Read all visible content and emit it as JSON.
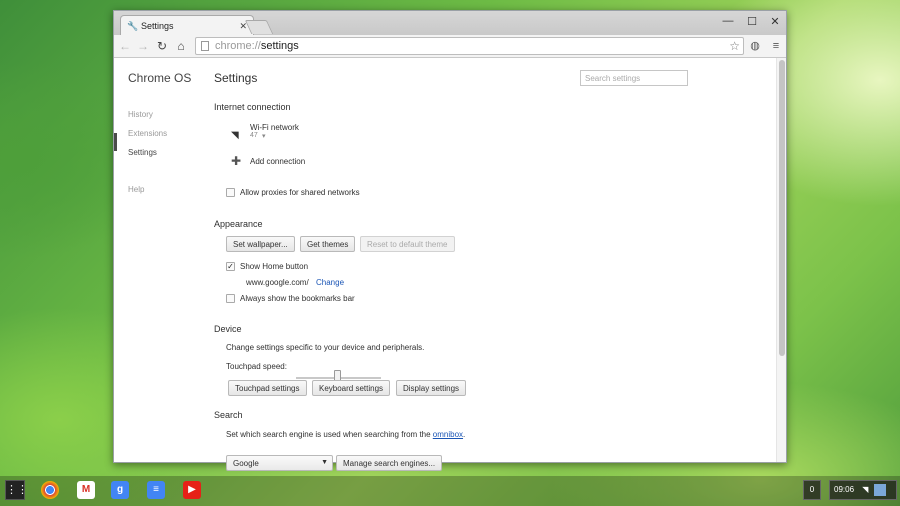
{
  "browser": {
    "tab_title": "Settings",
    "tab_close": "✕",
    "url_scheme": "chrome://",
    "url_host": "settings",
    "window_controls": [
      "—",
      "☐",
      "✕"
    ]
  },
  "sidebar": {
    "brand": "Chrome OS",
    "items": [
      {
        "label": "History"
      },
      {
        "label": "Extensions"
      },
      {
        "label": "Settings"
      },
      {
        "label": "Help"
      }
    ]
  },
  "main": {
    "title": "Settings",
    "search_placeholder": "Search settings",
    "internet": {
      "heading": "Internet connection",
      "network_name": "Wi-Fi network",
      "network_detail": "47",
      "add_connection": "Add connection",
      "allow_proxies": "Allow proxies for shared networks"
    },
    "appearance": {
      "heading": "Appearance",
      "set_wallpaper": "Set wallpaper...",
      "get_themes": "Get themes",
      "reset_theme": "Reset to default theme",
      "show_home": "Show Home button",
      "home_url": "www.google.com/",
      "change": "Change",
      "bookmarks_bar": "Always show the bookmarks bar"
    },
    "device": {
      "heading": "Device",
      "description": "Change settings specific to your device and peripherals.",
      "touchpad_speed": "Touchpad speed:",
      "touchpad_settings": "Touchpad settings",
      "keyboard_settings": "Keyboard settings",
      "display_settings": "Display settings"
    },
    "search": {
      "heading": "Search",
      "description_prefix": "Set which search engine is used when searching from the ",
      "omnibox_link": "omnibox",
      "description_suffix": ".",
      "engine": "Google",
      "manage": "Manage search engines..."
    }
  },
  "shelf": {
    "notifications": "0",
    "time": "09:06"
  },
  "colors": {
    "link": "#1a55b5",
    "accent_marker": "#4b4b4b"
  }
}
